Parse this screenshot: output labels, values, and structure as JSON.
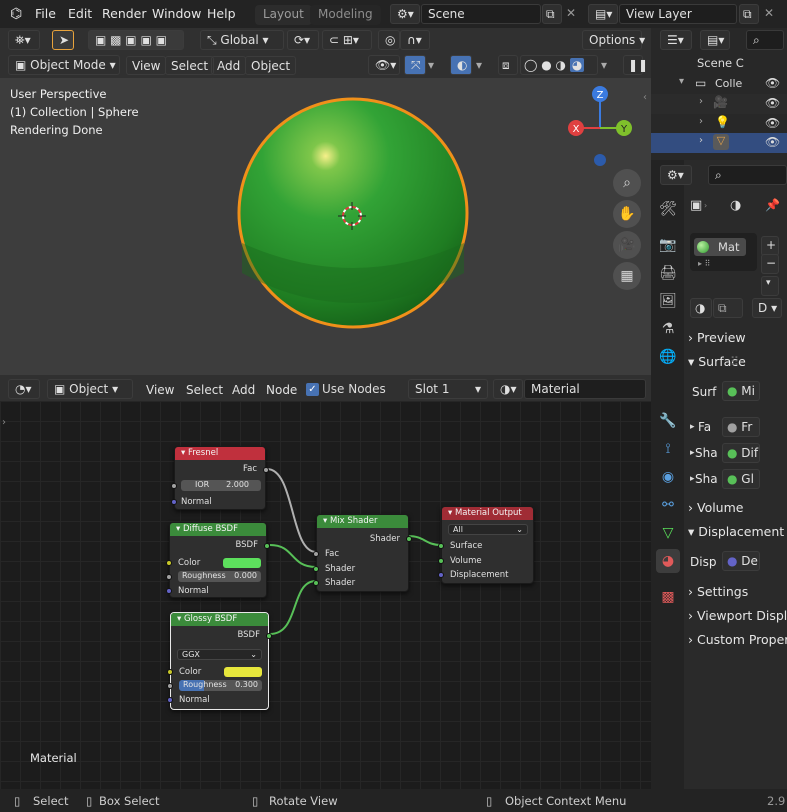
{
  "topbar": {
    "menus": [
      "File",
      "Edit",
      "Render",
      "Window",
      "Help"
    ],
    "workspaces": [
      "Layout",
      "Modeling"
    ],
    "scene": "Scene",
    "view_layer": "View Layer"
  },
  "viewport_header": {
    "transform_orientation": "Global",
    "options": "Options",
    "mode": "Object Mode",
    "menus": [
      "View",
      "Select",
      "Add",
      "Object"
    ]
  },
  "viewport": {
    "info_lines": [
      "User Perspective",
      "(1) Collection | Sphere",
      "Rendering Done"
    ],
    "gizmo": {
      "z": "Z",
      "x": "X",
      "y": "Y"
    },
    "sphere_color": "#2e9a2e",
    "outline_color": "#f0901a"
  },
  "node_header": {
    "mode": "Object",
    "menus": [
      "View",
      "Select",
      "Add",
      "Node"
    ],
    "use_nodes": "Use Nodes",
    "slot": "Slot 1",
    "material": "Material"
  },
  "nodes": {
    "fresnel": {
      "title": "Fresnel",
      "out": "Fac",
      "ior_label": "IOR",
      "ior_value": "2.000",
      "normal": "Normal"
    },
    "diffuse": {
      "title": "Diffuse BSDF",
      "out": "BSDF",
      "color": "Color",
      "roughness_label": "Roughness",
      "roughness_value": "0.000",
      "normal": "Normal",
      "swatch": "#5de05d"
    },
    "glossy": {
      "title": "Glossy BSDF",
      "out": "BSDF",
      "distribution": "GGX",
      "color": "Color",
      "roughness_label": "Roughness",
      "roughness_value": "0.300",
      "normal": "Normal",
      "swatch": "#e6e63c"
    },
    "mix": {
      "title": "Mix Shader",
      "out": "Shader",
      "in_fac": "Fac",
      "in_a": "Shader",
      "in_b": "Shader"
    },
    "output": {
      "title": "Material Output",
      "target": "All",
      "surface": "Surface",
      "volume": "Volume",
      "displacement": "Displacement"
    }
  },
  "node_editor_label": "Material",
  "outliner": {
    "scene": "Scene C",
    "collection": "Colle"
  },
  "properties": {
    "material_name": "Mat",
    "link": "D",
    "panels": [
      "Preview",
      "Surface",
      "Volume",
      "Displacement",
      "Settings",
      "Viewport Displ",
      "Custom Proper"
    ],
    "surface_label": "Surf",
    "surface_value": "Mi",
    "fa_label": "Fa",
    "fa_value": "Fr",
    "sha1_label": "Sha",
    "sha1_value": "Dif",
    "sha2_label": "Sha",
    "sha2_value": "Gl",
    "disp_label": "Disp",
    "disp_value": "De"
  },
  "statusbar": {
    "select": "Select",
    "box_select": "Box Select",
    "rotate_view": "Rotate View",
    "context_menu": "Object Context Menu",
    "version": "2.9"
  }
}
